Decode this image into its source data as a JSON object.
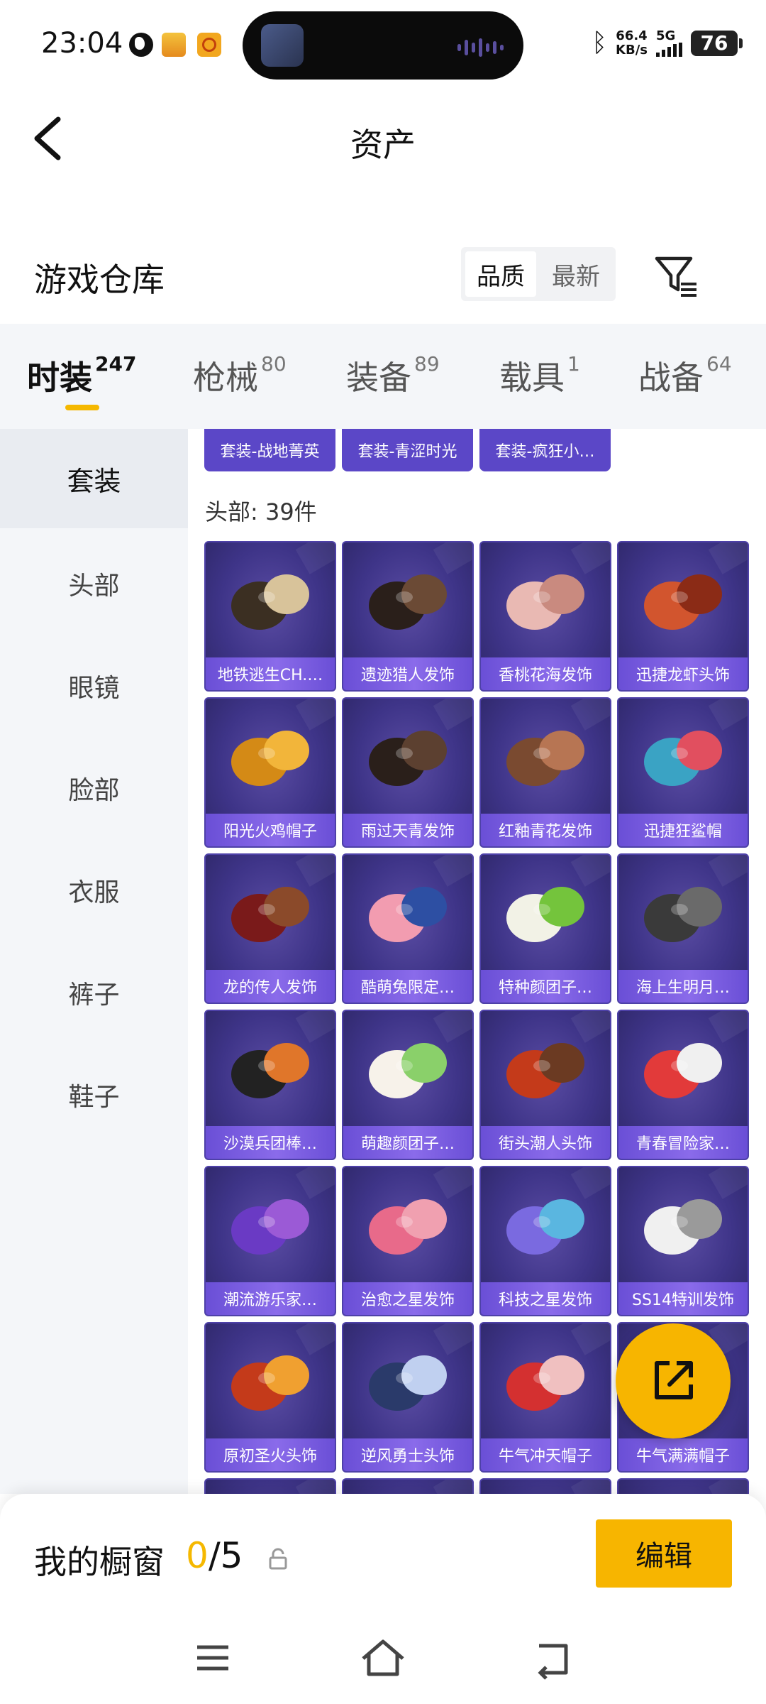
{
  "status_bar": {
    "time": "23:04",
    "net_speed_value": "66.4",
    "net_speed_unit": "KB/s",
    "network": "5G",
    "battery": "76"
  },
  "header": {
    "title": "资产"
  },
  "warehouse": {
    "title": "游戏仓库",
    "sort_options": [
      "品质",
      "最新"
    ],
    "sort_selected": "品质"
  },
  "tabs": [
    {
      "label": "时装",
      "count": "247",
      "active": true
    },
    {
      "label": "枪械",
      "count": "80"
    },
    {
      "label": "装备",
      "count": "89"
    },
    {
      "label": "载具",
      "count": "1"
    },
    {
      "label": "战备",
      "count": "64"
    }
  ],
  "sidebar": {
    "items": [
      {
        "label": "套装",
        "active": true
      },
      {
        "label": "头部"
      },
      {
        "label": "眼镜"
      },
      {
        "label": "脸部"
      },
      {
        "label": "衣服"
      },
      {
        "label": "裤子"
      },
      {
        "label": "鞋子"
      }
    ]
  },
  "suits": [
    "套装-战地菁英",
    "套装-青涩时光",
    "套装-疯狂小…"
  ],
  "section": {
    "label": "头部: 39件"
  },
  "items": [
    "地铁逃生CH.…",
    "遗迹猎人发饰",
    "香桃花海发饰",
    "迅捷龙虾头饰",
    "阳光火鸡帽子",
    "雨过天青发饰",
    "红釉青花发饰",
    "迅捷狂鲨帽",
    "龙的传人发饰",
    "酷萌兔限定…",
    "特种颜团子…",
    "海上生明月…",
    "沙漠兵团棒…",
    "萌趣颜团子…",
    "街头潮人头饰",
    "青春冒险家…",
    "潮流游乐家…",
    "治愈之星发饰",
    "科技之星发饰",
    "SS14特训发饰",
    "原初圣火头饰",
    "逆风勇士头饰",
    "牛气冲天帽子",
    "牛气满满帽子"
  ],
  "showcase": {
    "label": "我的橱窗",
    "current": "0",
    "total": "/5",
    "edit_label": "编辑"
  },
  "colors": {
    "accent": "#f7b500",
    "card_purple": "#3e3488",
    "label_purple": "#7a5ce0"
  }
}
